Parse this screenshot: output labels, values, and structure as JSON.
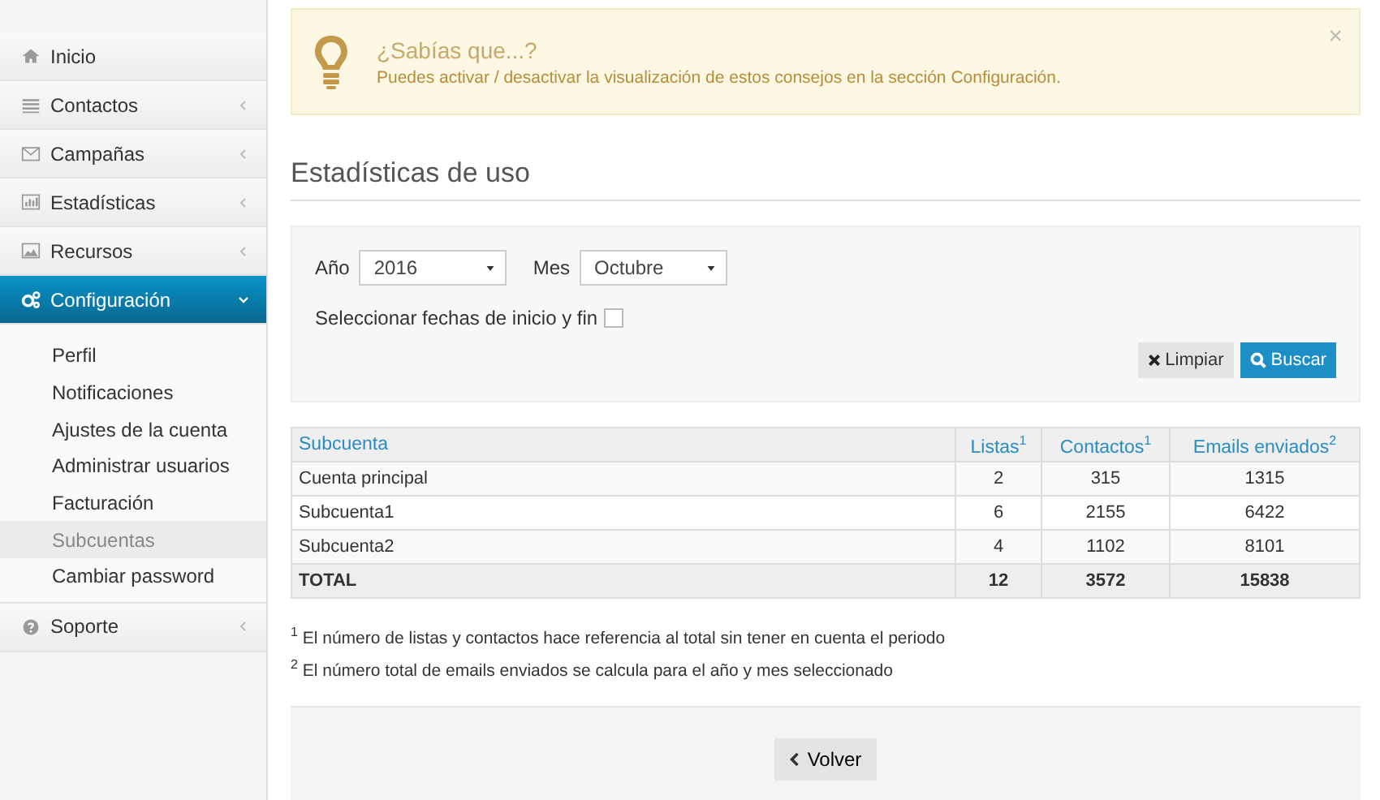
{
  "sidebar": {
    "items": [
      {
        "label": "Inicio",
        "selected": false
      },
      {
        "label": "Contactos",
        "selected": false,
        "expanded": false
      },
      {
        "label": "Campañas",
        "selected": false,
        "expanded": false
      },
      {
        "label": "Estadísticas",
        "selected": false,
        "expanded": false
      },
      {
        "label": "Recursos",
        "selected": false,
        "expanded": false
      },
      {
        "label": "Configuración",
        "selected": true,
        "expanded": true,
        "children": [
          {
            "label": "Perfil",
            "selected": false
          },
          {
            "label": "Notificaciones",
            "selected": false
          },
          {
            "label": "Ajustes de la cuenta",
            "selected": false
          },
          {
            "label": "Administrar usuarios",
            "selected": false
          },
          {
            "label": "Facturación",
            "selected": false
          },
          {
            "label": "Subcuentas",
            "selected": true
          },
          {
            "label": "Cambiar password",
            "selected": false
          }
        ]
      },
      {
        "label": "Soporte",
        "selected": false,
        "expanded": false
      }
    ]
  },
  "tip": {
    "title": "¿Sabías que...?",
    "text": "Puedes activar / desactivar la visualización de estos consejos en la sección Configuración.",
    "close": "×"
  },
  "heading": "Estadísticas de uso",
  "filters": {
    "year": {
      "label": "Año",
      "value": "2016"
    },
    "month": {
      "label": "Mes",
      "value": "Octubre"
    },
    "range": {
      "label": "Seleccionar fechas de inicio y fin",
      "checked": false
    },
    "buttons": [
      "Limpiar",
      "Buscar"
    ]
  },
  "table": {
    "columns": [
      "Subcuenta",
      "Listas$^{1}$",
      "Contactos$^{1}$",
      "Emails enviados$^{2}$"
    ],
    "rows": [
      [
        "Cuenta principal",
        "2",
        "315",
        "1315"
      ],
      [
        "Subcuenta1",
        "6",
        "2155",
        "6422"
      ],
      [
        "Subcuenta2",
        "4",
        "1102",
        "8101"
      ]
    ],
    "total": [
      "TOTAL",
      "12",
      "3572",
      "15838"
    ]
  },
  "footnotes": [
    "$^{1}$ El número de listas y contactos hace referencia al total sin tener en cuenta el periodo",
    "$^{2}$ El número total de emails enviados se calcula para el año y mes seleccionado"
  ],
  "back_button": "Volver"
}
